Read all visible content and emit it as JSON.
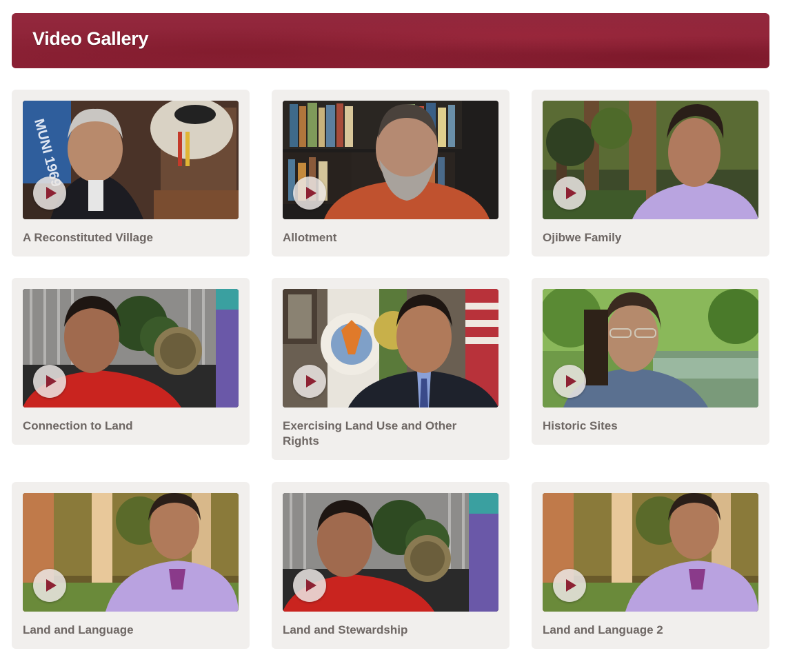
{
  "gallery": {
    "title": "Video Gallery",
    "videos": [
      {
        "title": "A Reconstituted Village",
        "icon": "play-icon"
      },
      {
        "title": "Allotment",
        "icon": "play-icon"
      },
      {
        "title": "Ojibwe Family",
        "icon": "play-icon"
      },
      {
        "title": "Connection to Land",
        "icon": "play-icon"
      },
      {
        "title": "Exercising Land Use and Other Rights",
        "icon": "play-icon"
      },
      {
        "title": "Historic Sites",
        "icon": "play-icon"
      },
      {
        "title": "Land and Language",
        "icon": "play-icon"
      },
      {
        "title": "Land and Stewardship",
        "icon": "play-icon"
      },
      {
        "title": "Land and Language 2",
        "icon": "play-icon"
      }
    ],
    "thumbnail_flag_text": "MUNI 1969"
  },
  "colors": {
    "header_bg": "#8a2034",
    "card_bg": "#f1efed",
    "title_text": "#6e6764",
    "header_text": "#ffffff"
  }
}
